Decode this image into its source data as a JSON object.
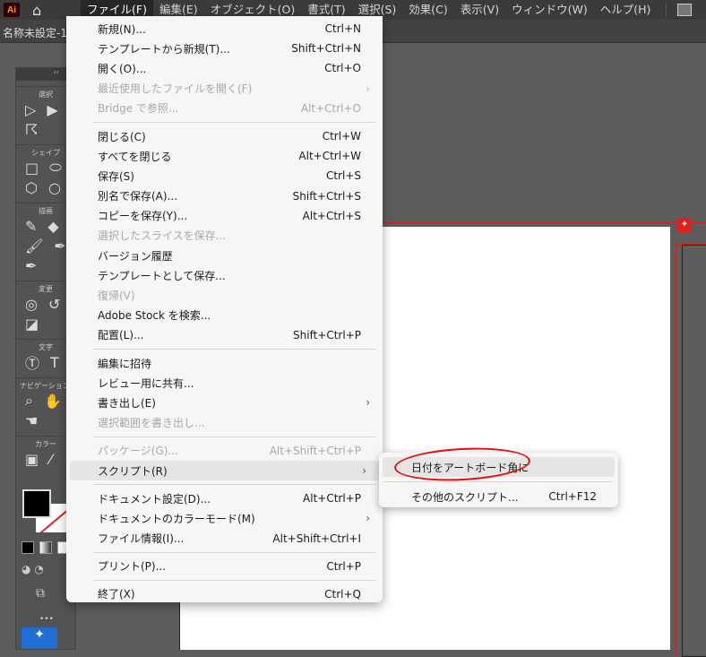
{
  "app": {
    "logo": "Ai",
    "doc_tab": "名称未設定-1"
  },
  "menubar": [
    "ファイル(F)",
    "編集(E)",
    "オブジェクト(O)",
    "書式(T)",
    "選択(S)",
    "効果(C)",
    "表示(V)",
    "ウィンドウ(W)",
    "ヘルプ(H)"
  ],
  "toolbar": {
    "collapse": "‹‹",
    "sections": [
      "選択",
      "シェイプ",
      "描画",
      "変更",
      "文字",
      "ナビゲーション",
      "カラー"
    ],
    "more": "•••"
  },
  "file_menu": [
    {
      "label": "新規(N)...",
      "shortcut": "Ctrl+N"
    },
    {
      "label": "テンプレートから新規(T)...",
      "shortcut": "Shift+Ctrl+N"
    },
    {
      "label": "開く(O)...",
      "shortcut": "Ctrl+O"
    },
    {
      "label": "最近使用したファイルを開く(F)",
      "shortcut": "",
      "disabled": true,
      "submenu": true
    },
    {
      "label": "Bridge で参照...",
      "shortcut": "Alt+Ctrl+O",
      "disabled": true
    },
    {
      "sep": true
    },
    {
      "label": "閉じる(C)",
      "shortcut": "Ctrl+W"
    },
    {
      "label": "すべてを閉じる",
      "shortcut": "Alt+Ctrl+W"
    },
    {
      "label": "保存(S)",
      "shortcut": "Ctrl+S"
    },
    {
      "label": "別名で保存(A)...",
      "shortcut": "Shift+Ctrl+S"
    },
    {
      "label": "コピーを保存(Y)...",
      "shortcut": "Alt+Ctrl+S"
    },
    {
      "label": "選択したスライスを保存...",
      "shortcut": "",
      "disabled": true
    },
    {
      "label": "バージョン履歴",
      "shortcut": ""
    },
    {
      "label": "テンプレートとして保存...",
      "shortcut": ""
    },
    {
      "label": "復帰(V)",
      "shortcut": "",
      "disabled": true
    },
    {
      "label": "Adobe Stock を検索...",
      "shortcut": ""
    },
    {
      "label": "配置(L)...",
      "shortcut": "Shift+Ctrl+P"
    },
    {
      "sep": true
    },
    {
      "label": "編集に招待",
      "shortcut": ""
    },
    {
      "label": "レビュー用に共有...",
      "shortcut": ""
    },
    {
      "label": "書き出し(E)",
      "shortcut": "",
      "submenu": true
    },
    {
      "label": "選択範囲を書き出し...",
      "shortcut": "",
      "disabled": true
    },
    {
      "sep": true
    },
    {
      "label": "パッケージ(G)...",
      "shortcut": "Alt+Shift+Ctrl+P",
      "disabled": true
    },
    {
      "label": "スクリプト(R)",
      "shortcut": "",
      "submenu": true,
      "highlighted": true
    },
    {
      "sep": true
    },
    {
      "label": "ドキュメント設定(D)...",
      "shortcut": "Alt+Ctrl+P"
    },
    {
      "label": "ドキュメントのカラーモード(M)",
      "shortcut": "",
      "submenu": true
    },
    {
      "label": "ファイル情報(I)...",
      "shortcut": "Alt+Shift+Ctrl+I"
    },
    {
      "sep": true
    },
    {
      "label": "プリント(P)...",
      "shortcut": "Ctrl+P"
    },
    {
      "sep": true
    },
    {
      "label": "終了(X)",
      "shortcut": "Ctrl+Q"
    }
  ],
  "script_submenu": [
    {
      "label": "日付をアートボード角に",
      "shortcut": "",
      "highlighted": true
    },
    {
      "sep": true
    },
    {
      "label": "その他のスクリプト...",
      "shortcut": "Ctrl+F12"
    }
  ],
  "colors": {
    "annotation": "#e01010",
    "accent": "#1f6ed4"
  }
}
